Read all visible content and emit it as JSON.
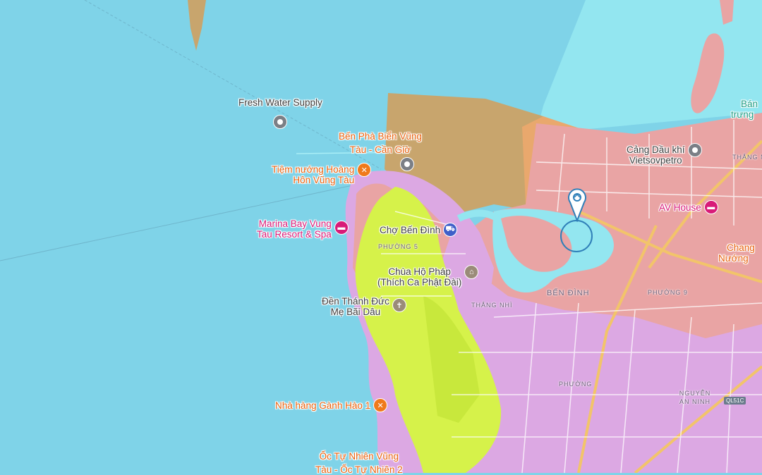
{
  "map": {
    "colors": {
      "sea": "#7fd3e8",
      "sea_light": "#93e6f0",
      "zone_tan": "#c8a56d",
      "zone_orange": "#e9a86d",
      "urban_pink": "#e9a4a4",
      "residential_violet": "#dca8e3",
      "forest_lime": "#d6f24a",
      "selection_ring": "#2f7fb8"
    },
    "pois": [
      {
        "id": "fresh-water-supply",
        "label": "Fresh Water Supply",
        "icon": "pin-grey",
        "style": "grey"
      },
      {
        "id": "ben-pha",
        "label_lines": [
          "Bến Phà Biển Vũng",
          "Tàu - Cần Giờ"
        ],
        "icon": "pin-grey",
        "style": "orange"
      },
      {
        "id": "tiem-nuong",
        "label_lines": [
          "Tiệm nướng Hoàng",
          "Hôn Vũng Tàu"
        ],
        "icon": "fork-knife-icon",
        "style": "orange"
      },
      {
        "id": "marina-bay",
        "label_lines": [
          "Marina Bay Vung",
          "Tau Resort & Spa"
        ],
        "icon": "hotel-bed-icon",
        "style": "pink"
      },
      {
        "id": "cho-ben-dinh",
        "label": "Chợ Bến Đình",
        "icon": "shopping-cart-icon",
        "style": "grey"
      },
      {
        "id": "chua-ho-phap",
        "label_lines": [
          "Chùa Hộ Pháp",
          "(Thích Ca Phật Đài)"
        ],
        "icon": "temple-icon",
        "style": "grey"
      },
      {
        "id": "den-thanh-duc",
        "label_lines": [
          "Đền Thánh Đức",
          "Mẹ Bãi Dâu"
        ],
        "icon": "church-icon",
        "style": "grey"
      },
      {
        "id": "cang-dau-khi",
        "label_lines": [
          "Cảng Dầu khí",
          "Vietsovpetro"
        ],
        "icon": "pin-grey",
        "style": "grey"
      },
      {
        "id": "av-house",
        "label": "AV House",
        "icon": "hotel-bed-icon",
        "style": "pink"
      },
      {
        "id": "nha-hang-ganh-hao",
        "label": "Nhà hàng Gành Hào 1",
        "icon": "fork-knife-icon",
        "style": "orange"
      },
      {
        "id": "oc-tu-nhien",
        "label_lines": [
          "Ốc Tự Nhiên Vũng",
          "Tàu - Ốc Tự Nhiên 2"
        ],
        "icon": "fork-knife-icon",
        "style": "orange"
      }
    ],
    "areas": [
      "PHƯỜNG 5",
      "BẾN ĐÌNH",
      "THẮNG NHÌ",
      "PHƯỜNG 9",
      "PHƯỜNG",
      "NGUYỄN AN NINH",
      "THẮNG N"
    ],
    "partial_labels": [
      "Bán",
      "trưng",
      "Chang",
      "Nướng"
    ],
    "road_shield": "QL51C",
    "selected_marker": {
      "icon": "location-pin-icon"
    }
  }
}
